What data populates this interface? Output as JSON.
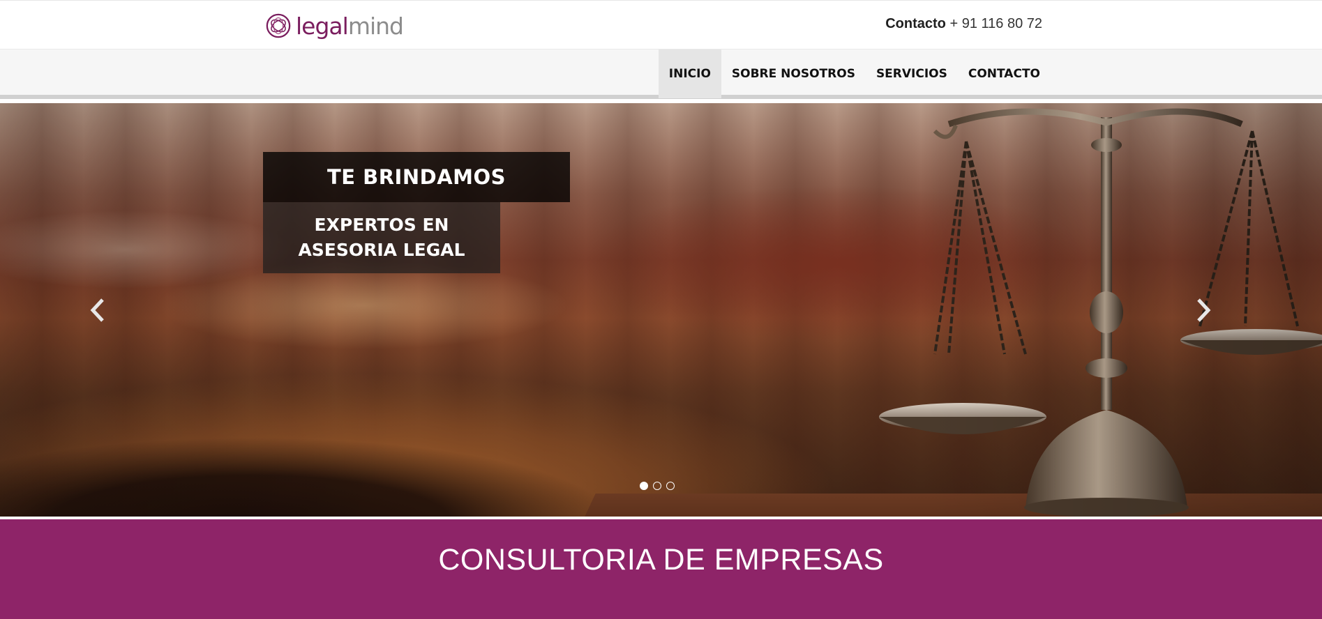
{
  "header": {
    "logo": {
      "part1": "legal",
      "part2": "mind"
    },
    "contact": {
      "label": "Contacto",
      "phone": "+ 91 116 80 72"
    }
  },
  "nav": {
    "items": [
      {
        "label": "INICIO",
        "active": true
      },
      {
        "label": "SOBRE NOSOTROS",
        "active": false
      },
      {
        "label": "SERVICIOS",
        "active": false
      },
      {
        "label": "CONTACTO",
        "active": false
      }
    ]
  },
  "hero": {
    "caption_line1": "TE BRINDAMOS",
    "caption_line2": "EXPERTOS EN ASESORIA LEGAL",
    "prev_icon": "chevron-left-icon",
    "next_icon": "chevron-right-icon",
    "slides_count": 3,
    "active_slide": 1
  },
  "banner": {
    "title": "CONSULTORIA DE EMPRESAS"
  },
  "colors": {
    "brand": "#8e2468",
    "logo_accent": "#7a1d5e",
    "logo_grey": "#8c8c8c",
    "nav_active_bg": "#e5e5e5"
  }
}
